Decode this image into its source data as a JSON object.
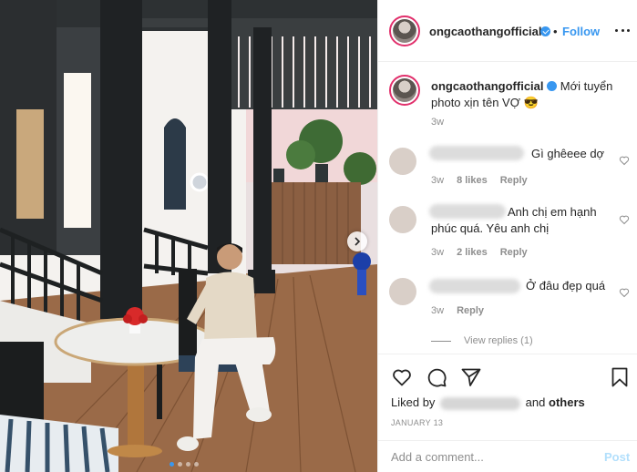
{
  "header": {
    "username": "ongcaothangofficial",
    "separator": "•",
    "follow_label": "Follow",
    "more_icon": "more-horizontal-icon"
  },
  "caption": {
    "username": "ongcaothangofficial",
    "text": "Mới tuyển photo xịn tên VỢ 😎",
    "time": "3w"
  },
  "comments": [
    {
      "text": "Gì ghêeee dợ",
      "time": "3w",
      "likes": "8 likes",
      "reply_label": "Reply"
    },
    {
      "text": "Anh chị em hạnh phúc quá. Yêu anh chị",
      "time": "3w",
      "likes": "2 likes",
      "reply_label": "Reply"
    },
    {
      "text": "Ở đâu đẹp quá",
      "time": "3w",
      "reply_label": "Reply"
    }
  ],
  "view_replies_label": "View replies (1)",
  "actions": {
    "like_icon": "heart-icon",
    "comment_icon": "comment-icon",
    "share_icon": "share-icon",
    "save_icon": "bookmark-icon"
  },
  "likes_line": {
    "prefix": "Liked by",
    "middle": "and",
    "suffix": "others"
  },
  "date": "JANUARY 13",
  "comment_box": {
    "placeholder": "Add a comment...",
    "post_label": "Post"
  },
  "carousel": {
    "count": 4,
    "active_index": 0
  },
  "colors": {
    "accent": "#3897f0",
    "muted": "#8e8e8e",
    "text": "#262626",
    "post_disabled": "#b2dffc"
  }
}
